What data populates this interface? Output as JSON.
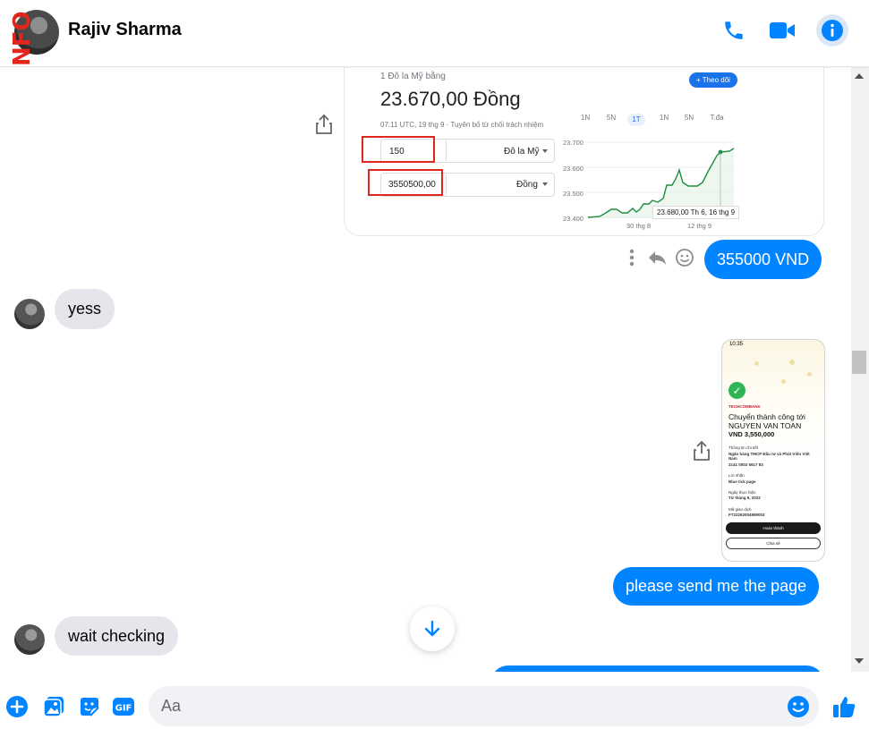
{
  "header": {
    "contact_name": "Rajiv Sharma",
    "avatar_stamp": "NFO",
    "icons": [
      "phone-icon",
      "video-icon",
      "info-icon"
    ]
  },
  "colors": {
    "accent": "#0084ff",
    "incoming_bubble": "#e4e6eb",
    "highlight_box": "#e0261d",
    "success": "#2fb456"
  },
  "exchange_card": {
    "caption": "1 Đô la Mỹ bằng",
    "rate": "23.670,00 Đồng",
    "timestamp": "07:11 UTC, 19 thg 9 · Tuyên bố từ chối trách nhiệm",
    "follow_label": "+ Theo dõi",
    "ranges": [
      "1N",
      "5N",
      "1T",
      "1N",
      "5N",
      "T.đa"
    ],
    "input_amount": "150",
    "input_currency": "Đô la Mỹ",
    "output_amount": "3550500,00",
    "output_currency": "Đồng",
    "axis": [
      "23.700",
      "23.600",
      "23.500",
      "23.400"
    ],
    "dates": [
      "30 thg 8",
      "12 thg 9"
    ],
    "tooltip": "23.680,00  Th 6, 16 thg 9"
  },
  "messages": [
    {
      "dir": "out",
      "text": "355000 VND"
    },
    {
      "dir": "in",
      "text": "yess"
    },
    {
      "dir": "out",
      "text": "please send me the page"
    },
    {
      "dir": "in",
      "text": "wait checking"
    }
  ],
  "receipt_card": {
    "time": "10:35",
    "bank": "TECHCOMBANK",
    "title": "Chuyển thành công tới NGUYEN VAN TOAN",
    "amount": "VND 3,550,000",
    "lines": [
      "Thông tin chi tiết",
      "Ngân hàng TMCP Đầu tư và Phát triển Việt Nam",
      "2141 0002 6617 83",
      "Lời nhắn",
      "Blue tick page",
      "Ngày thực hiện",
      "Từ tháng 9, 2022",
      "Mã giao dịch",
      "FT22262004989003"
    ],
    "primary_button": "Hoàn thành",
    "secondary_button": "Chia sẻ"
  },
  "composer": {
    "placeholder": "Aa",
    "icons": [
      "plus-icon",
      "photo-icon",
      "sticker-icon",
      "gif-icon",
      "emoji-icon",
      "like-icon"
    ]
  }
}
